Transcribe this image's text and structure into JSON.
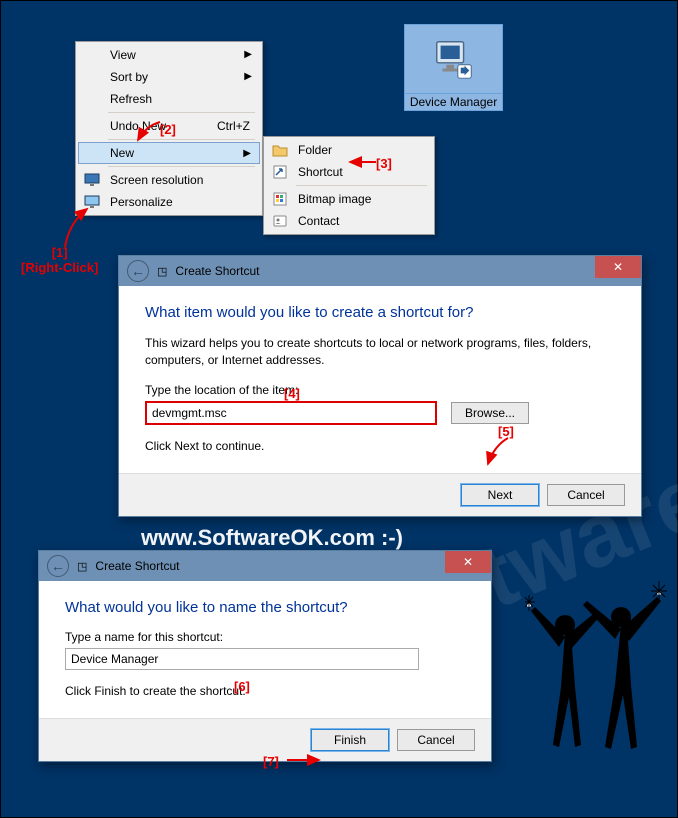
{
  "watermark": "www.SoftwareOK.com :-)",
  "desktop_icon": {
    "label": "Device Manager"
  },
  "menu1": {
    "view": "View",
    "sortby": "Sort by",
    "refresh": "Refresh",
    "undo": "Undo New",
    "undo_shortcut": "Ctrl+Z",
    "new": "New",
    "screenres": "Screen resolution",
    "personalize": "Personalize"
  },
  "menu2": {
    "folder": "Folder",
    "shortcut": "Shortcut",
    "bitmap": "Bitmap image",
    "contact": "Contact"
  },
  "dialog1": {
    "title": "Create Shortcut",
    "heading": "What item would you like to create a shortcut for?",
    "help": "This wizard helps you to create shortcuts to local or network programs, files, folders, computers, or   Internet addresses.",
    "field_label": "Type the location of the item:",
    "field_value": "devmgmt.msc",
    "browse": "Browse...",
    "hint": "Click Next to continue.",
    "next": "Next",
    "cancel": "Cancel"
  },
  "dialog2": {
    "title": "Create Shortcut",
    "heading": "What would you like to name the shortcut?",
    "field_label": "Type a name for this shortcut:",
    "field_value": "Device Manager",
    "hint": "Click Finish to create the shortcut.",
    "finish": "Finish",
    "cancel": "Cancel"
  },
  "callouts": {
    "c1a": "[1]",
    "c1b": "[Right-Click]",
    "c2": "[2]",
    "c3": "[3]",
    "c4": "[4]",
    "c5": "[5]",
    "c6": "[6]",
    "c7": "[7]"
  }
}
